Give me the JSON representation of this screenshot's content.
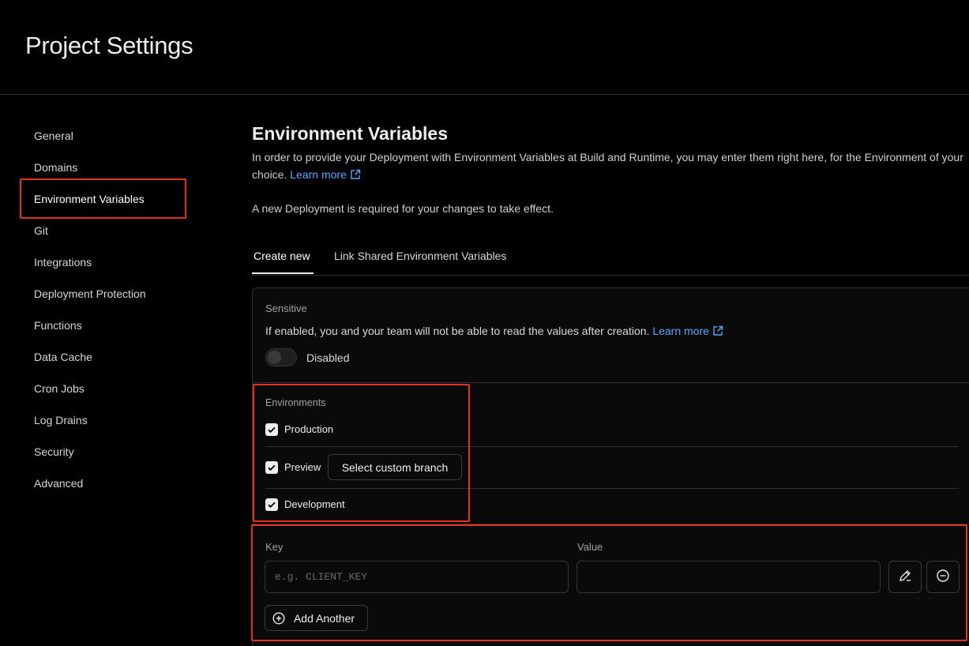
{
  "header": {
    "title": "Project Settings"
  },
  "sidebar": {
    "items": [
      {
        "label": "General"
      },
      {
        "label": "Domains"
      },
      {
        "label": "Environment Variables",
        "active": true
      },
      {
        "label": "Git"
      },
      {
        "label": "Integrations"
      },
      {
        "label": "Deployment Protection"
      },
      {
        "label": "Functions"
      },
      {
        "label": "Data Cache"
      },
      {
        "label": "Cron Jobs"
      },
      {
        "label": "Log Drains"
      },
      {
        "label": "Security"
      },
      {
        "label": "Advanced"
      }
    ]
  },
  "main": {
    "title": "Environment Variables",
    "description": "In order to provide your Deployment with Environment Variables at Build and Runtime, you may enter them right here, for the Environment of your choice.",
    "learn_more": "Learn more",
    "notice": "A new Deployment is required for your changes to take effect.",
    "tabs": [
      {
        "label": "Create new",
        "active": true
      },
      {
        "label": "Link Shared Environment Variables"
      }
    ],
    "sensitive": {
      "label": "Sensitive",
      "description": "If enabled, you and your team will not be able to read the values after creation.",
      "learn_more": "Learn more",
      "toggle_state": "Disabled",
      "enabled": false
    },
    "environments": {
      "label": "Environments",
      "items": [
        {
          "label": "Production",
          "checked": true
        },
        {
          "label": "Preview",
          "checked": true,
          "branch_button": "Select custom branch"
        },
        {
          "label": "Development",
          "checked": true
        }
      ]
    },
    "variables": {
      "key_label": "Key",
      "value_label": "Value",
      "key_placeholder": "e.g. CLIENT_KEY",
      "key_value": "",
      "value_value": "",
      "add_another": "Add Another"
    }
  },
  "colors": {
    "accent_link": "#52a8ff",
    "highlight": "#e5331b",
    "background": "#000000",
    "text": "#ededed"
  }
}
